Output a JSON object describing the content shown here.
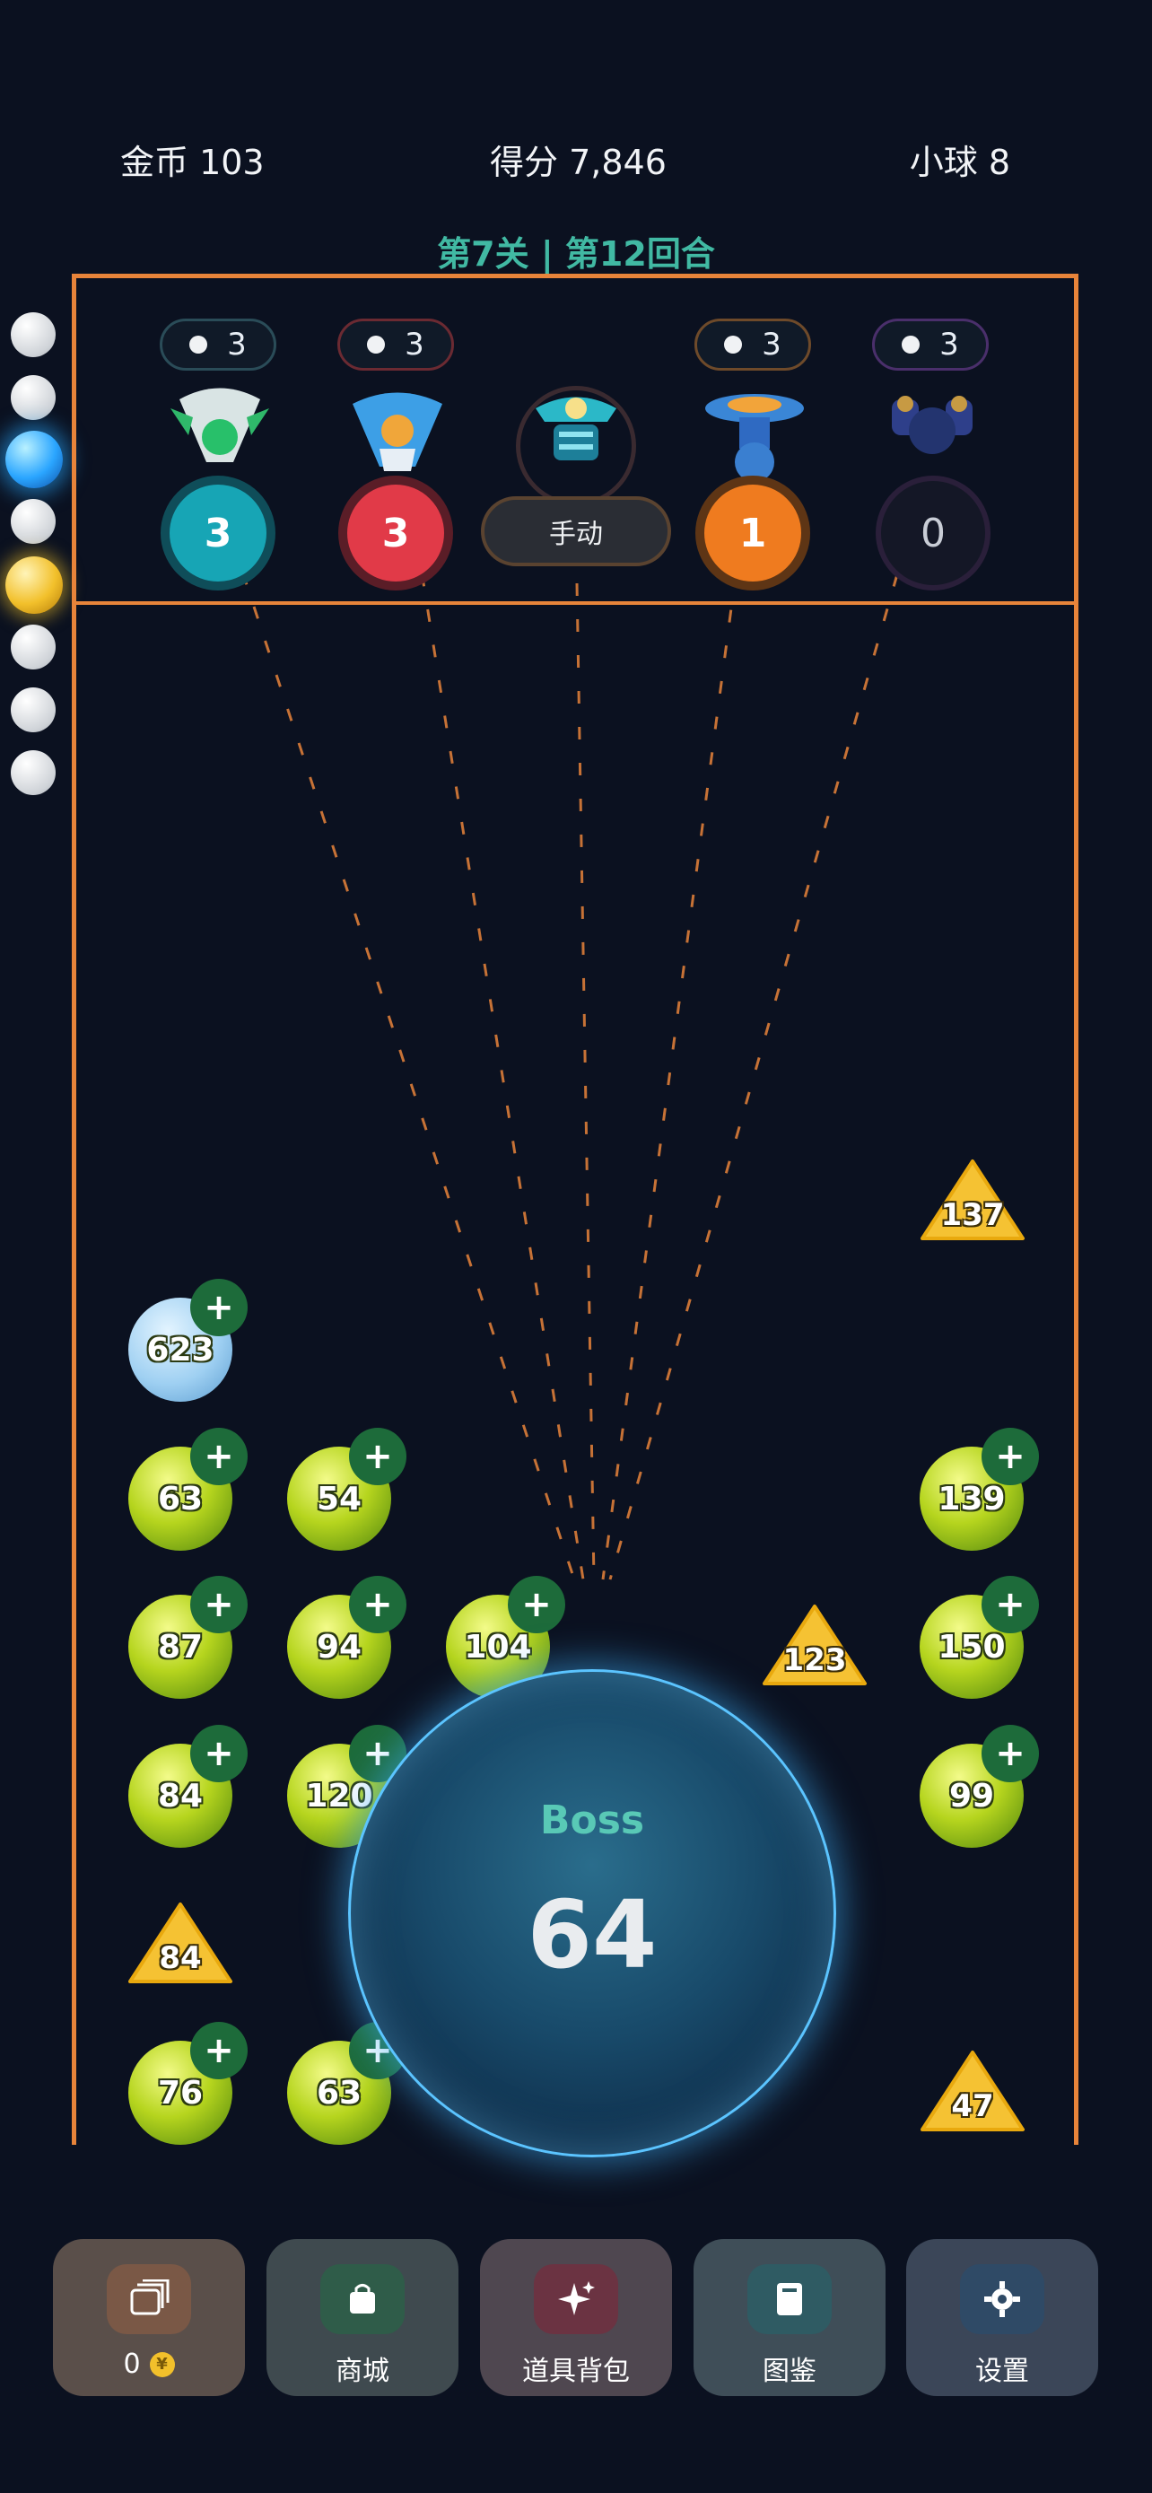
{
  "hud": {
    "coins": "金币 103",
    "score": "得分 7,846",
    "balls": "小球 8"
  },
  "level_title": "第7关 | 第12回合",
  "turrets": [
    {
      "ammo": "3",
      "level": "3",
      "color": "#17a5b5"
    },
    {
      "ammo": "3",
      "level": "3",
      "color": "#e13a48"
    },
    {
      "mode_button": "手动"
    },
    {
      "ammo": "3",
      "level": "1",
      "color": "#ef7b1f"
    },
    {
      "ammo": "3",
      "level": "0",
      "color": "#5a4a7a"
    }
  ],
  "side_balls": [
    "white",
    "white",
    "blue-glow",
    "white",
    "gold-lightning",
    "white",
    "white",
    "white"
  ],
  "blocks": {
    "balls": [
      {
        "value": "623",
        "kind": "ice",
        "plus": true
      },
      {
        "value": "63",
        "plus": true
      },
      {
        "value": "54",
        "plus": true
      },
      {
        "value": "139",
        "plus": true
      },
      {
        "value": "87",
        "plus": true
      },
      {
        "value": "94",
        "plus": true
      },
      {
        "value": "104",
        "plus": true
      },
      {
        "value": "150",
        "plus": true
      },
      {
        "value": "84",
        "plus": true
      },
      {
        "value": "120",
        "plus": true
      },
      {
        "value": "99",
        "plus": true
      },
      {
        "value": "76",
        "plus": true
      },
      {
        "value": "63",
        "plus": true
      }
    ],
    "triangles": [
      "137",
      "123",
      "84",
      "47"
    ]
  },
  "boss": {
    "label": "Boss",
    "hp": "64"
  },
  "toolbar": {
    "items": [
      {
        "label": "0",
        "icon": "cards-icon",
        "color": "#7a5846"
      },
      {
        "label": "商城",
        "icon": "bag-icon",
        "color": "#2f5c49"
      },
      {
        "label": "道具背包",
        "icon": "sparkle-icon",
        "color": "#6b3342"
      },
      {
        "label": "图鉴",
        "icon": "book-icon",
        "color": "#2f5b63"
      },
      {
        "label": "设置",
        "icon": "gear-icon",
        "color": "#2f4a66"
      }
    ],
    "plus_symbol": "+"
  },
  "colors": {
    "accent_orange": "#e8843a",
    "teal_text": "#41b9a3",
    "background": "#0b1120"
  }
}
